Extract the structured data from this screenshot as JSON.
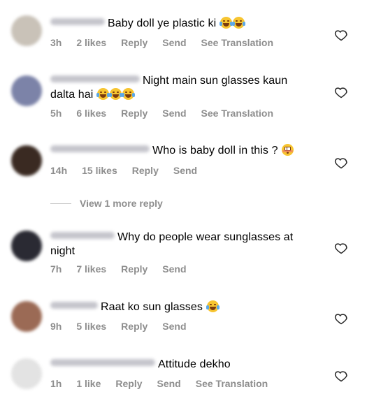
{
  "comments": [
    {
      "text": "Baby doll ye plastic ki",
      "emojis": [
        "face-with-tears-of-joy",
        "face-with-tears-of-joy"
      ],
      "time": "3h",
      "likes": "2 likes",
      "reply": "Reply",
      "send": "Send",
      "translate": "See Translation",
      "avatar_color": "#c9c2b8"
    },
    {
      "text_line1": "Night main sun glasses kaun",
      "text_line2": "dalta hai",
      "emojis": [
        "face-with-tears-of-joy",
        "face-with-tears-of-joy",
        "face-with-tears-of-joy"
      ],
      "time": "5h",
      "likes": "6 likes",
      "reply": "Reply",
      "send": "Send",
      "translate": "See Translation",
      "avatar_color": "#7c83a8"
    },
    {
      "text": "Who is baby doll in this ?",
      "emojis": [
        "flushed-face"
      ],
      "time": "14h",
      "likes": "15 likes",
      "reply": "Reply",
      "send": "Send",
      "avatar_color": "#3a2a22"
    },
    {
      "text_line1": "Why do people wear sunglasses at",
      "text_line2": "night",
      "time": "7h",
      "likes": "7 likes",
      "reply": "Reply",
      "send": "Send",
      "avatar_color": "#2a2a33"
    },
    {
      "text": "Raat ko sun glasses",
      "emojis": [
        "face-with-tears-of-joy"
      ],
      "time": "9h",
      "likes": "5 likes",
      "reply": "Reply",
      "send": "Send",
      "avatar_color": "#9b6a55"
    },
    {
      "text": "Attitude dekho",
      "time": "1h",
      "likes": "1 like",
      "reply": "Reply",
      "send": "Send",
      "translate": "See Translation",
      "avatar_color": "#e3e3e3"
    }
  ],
  "view_more": "View 1 more reply",
  "colors": {
    "meta": "#8e8e8e",
    "username_blur": "#c5c5cc",
    "heart": "#262626"
  }
}
